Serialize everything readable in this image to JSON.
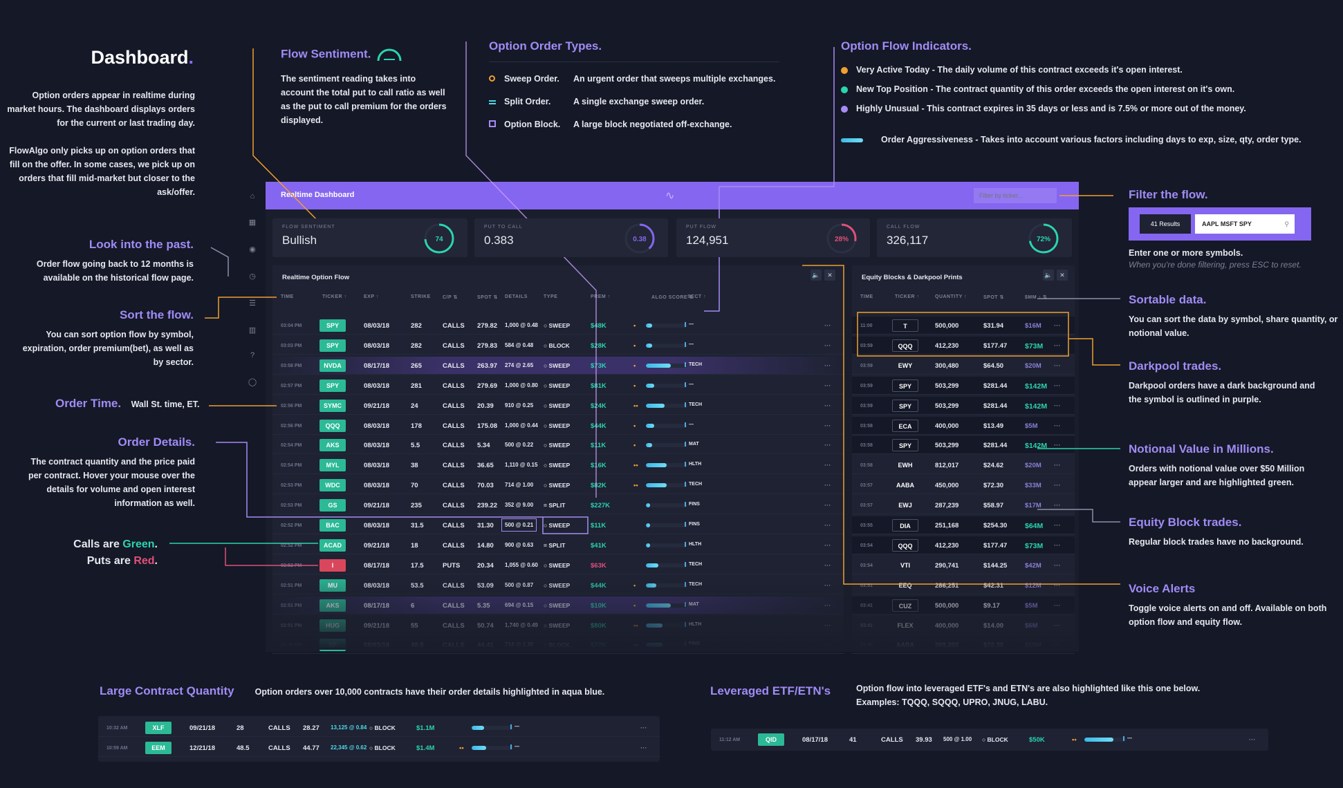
{
  "colors": {
    "accent": "#8566f0",
    "green": "#2bb996",
    "red": "#d9475c",
    "orange": "#f0a030",
    "aqua": "#4fd8e8"
  },
  "intro": {
    "title": "Dashboard",
    "p1": "Option orders appear in realtime during market hours. The dashboard displays orders for the current or last trading day.",
    "p2": "FlowAlgo only picks up on option orders that fill on the offer. In some cases, we pick up on orders that fill mid-market but closer to the ask/offer."
  },
  "left_notes": [
    {
      "title": "Look into the past.",
      "text": "Order flow going back to 12 months is available on the historical flow page."
    },
    {
      "title": "Sort the flow.",
      "text": "You can sort option flow by symbol, expiration, order premium(bet), as well as by sector."
    },
    {
      "title": "Order Time.",
      "text": "Wall St. time, ET."
    },
    {
      "title": "Order Details.",
      "text": "The contract quantity and the price paid per contract. Hover your mouse over the details for volume and open interest information as well."
    }
  ],
  "calls_puts": {
    "a": "Calls are ",
    "green": "Green",
    "b": "Puts are ",
    "red": "Red"
  },
  "sentiment_note": {
    "title": "Flow Sentiment.",
    "text": "The sentiment reading takes into account the total put to call ratio as well as the put to call premium for the orders displayed."
  },
  "order_types": {
    "title": "Option Order Types.",
    "items": [
      {
        "icon": "circle-outline-icon",
        "name": "Sweep Order.",
        "desc": "An urgent order that sweeps multiple exchanges."
      },
      {
        "icon": "double-line-icon",
        "name": "Split Order.",
        "desc": "A single exchange sweep order."
      },
      {
        "icon": "square-outline-icon",
        "name": "Option Block.",
        "desc": "A large block negotiated off-exchange."
      }
    ]
  },
  "indicators": {
    "title": "Option Flow Indicators.",
    "items": [
      {
        "color": "#f0a030",
        "name": "Very Active Today",
        "desc": " - The daily volume of this contract exceeds it's open interest."
      },
      {
        "color": "#2bd4b0",
        "name": "New Top Position",
        "desc": " - The contract quantity of this order exceeds the open interest on it's own."
      },
      {
        "color": "#a58cf5",
        "name": "Highly Unusual",
        "desc": " - This contract expires in 35 days or less and is 7.5% or more out of the money."
      },
      {
        "color": "bar",
        "name": "Order Aggressiveness",
        "desc": " - Takes into account various factors including days to exp, size, qty, order type."
      }
    ]
  },
  "right_notes": {
    "filter": {
      "title": "Filter the flow.",
      "results": "41 Results",
      "value": "AAPL MSFT SPY",
      "text": "Enter one or more symbols.",
      "hint": "When you're done filtering, press ESC to reset."
    },
    "sortable": {
      "title": "Sortable data.",
      "text": "You can sort the data by symbol, share quantity, or notional value."
    },
    "darkpool": {
      "title": "Darkpool trades.",
      "text": "Darkpool orders have a dark background and the symbol is outlined in purple."
    },
    "notional": {
      "title": "Notional Value in Millions.",
      "text": "Orders with notional value over $50 Million appear larger and are highlighted green."
    },
    "block": {
      "title": "Equity Block trades.",
      "text": "Regular block trades have no background."
    },
    "voice": {
      "title": "Voice Alerts",
      "text": "Toggle voice alerts on and off. Available on both option flow and equity flow."
    }
  },
  "app": {
    "header_title": "Realtime Dashboard",
    "search_placeholder": "Filter by ticker...",
    "cards": [
      {
        "label": "FLOW SENTIMENT",
        "value": "Bullish",
        "gauge": "74",
        "pct": 0.74,
        "color": "#2bd4b0"
      },
      {
        "label": "PUT TO CALL",
        "value": "0.383",
        "gauge": "0.38",
        "pct": 0.38,
        "color": "#8566f0"
      },
      {
        "label": "PUT FLOW",
        "value": "124,951",
        "gauge": "28%",
        "pct": 0.28,
        "color": "#e0507a"
      },
      {
        "label": "CALL FLOW",
        "value": "326,117",
        "gauge": "72%",
        "pct": 0.72,
        "color": "#2bd4b0"
      }
    ],
    "flow": {
      "title": "Realtime Option Flow",
      "headers": [
        "TIME",
        "TICKER ↑",
        "EXP ↑",
        "STRIKE",
        "C/P ⇅",
        "SPOT ⇅",
        "DETAILS",
        "TYPE",
        "PREM ↑",
        "ALGO SCORE ⇅",
        "SECT ↑"
      ],
      "rows": [
        [
          "03:04 PM",
          "SPY",
          "08/03/18",
          "282",
          "CALLS",
          "279.82",
          "1,000 @ 0.48",
          "SWEEP",
          "$48K",
          1,
          0.15,
          "—"
        ],
        [
          "03:03 PM",
          "SPY",
          "08/03/18",
          "282",
          "CALLS",
          "279.83",
          "584 @ 0.48",
          "BLOCK",
          "$28K",
          1,
          0.15,
          "—"
        ],
        [
          "03:58 PM",
          "NVDA",
          "08/17/18",
          "265",
          "CALLS",
          "263.97",
          "274 @ 2.65",
          "SWEEP",
          "$73K",
          1,
          0.6,
          "TECH"
        ],
        [
          "02:57 PM",
          "SPY",
          "08/03/18",
          "281",
          "CALLS",
          "279.69",
          "1,000 @ 0.80",
          "SWEEP",
          "$81K",
          1,
          0.2,
          "—"
        ],
        [
          "02:56 PM",
          "SYMC",
          "09/21/18",
          "24",
          "CALLS",
          "20.39",
          "910 @ 0.25",
          "SWEEP",
          "$24K",
          2,
          0.45,
          "TECH"
        ],
        [
          "02:56 PM",
          "QQQ",
          "08/03/18",
          "178",
          "CALLS",
          "175.08",
          "1,000 @ 0.44",
          "SWEEP",
          "$44K",
          1,
          0.2,
          "—"
        ],
        [
          "02:54 PM",
          "AKS",
          "08/03/18",
          "5.5",
          "CALLS",
          "5.34",
          "500 @ 0.22",
          "SWEEP",
          "$11K",
          1,
          0.15,
          "MAT"
        ],
        [
          "02:54 PM",
          "MYL",
          "08/03/18",
          "38",
          "CALLS",
          "36.65",
          "1,110 @ 0.15",
          "SWEEP",
          "$16K",
          2,
          0.5,
          "HLTH"
        ],
        [
          "02:53 PM",
          "WDC",
          "08/03/18",
          "70",
          "CALLS",
          "70.03",
          "714 @ 1.00",
          "SWEEP",
          "$82K",
          2,
          0.5,
          "TECH"
        ],
        [
          "02:53 PM",
          "GS",
          "09/21/18",
          "235",
          "CALLS",
          "239.22",
          "352 @ 9.00",
          "SPLIT",
          "$227K",
          0,
          0.1,
          "FINS"
        ],
        [
          "02:52 PM",
          "BAC",
          "08/03/18",
          "31.5",
          "CALLS",
          "31.30",
          "500 @ 0.21",
          "SWEEP",
          "$11K",
          0,
          0.1,
          "FINS"
        ],
        [
          "02:52 PM",
          "ACAD",
          "09/21/18",
          "18",
          "CALLS",
          "14.80",
          "900 @ 0.63",
          "SPLIT",
          "$41K",
          0,
          0.1,
          "HLTH"
        ],
        [
          "02:52 PM",
          "I",
          "08/17/18",
          "17.5",
          "PUTS",
          "20.34",
          "1,055 @ 0.60",
          "SWEEP",
          "$63K",
          0,
          0.3,
          "TECH"
        ],
        [
          "02:51 PM",
          "MU",
          "08/03/18",
          "53.5",
          "CALLS",
          "53.09",
          "500 @ 0.87",
          "SWEEP",
          "$44K",
          1,
          0.25,
          "TECH"
        ],
        [
          "02:51 PM",
          "AKS",
          "08/17/18",
          "6",
          "CALLS",
          "5.35",
          "694 @ 0.15",
          "SWEEP",
          "$10K",
          1,
          0.6,
          "MAT"
        ],
        [
          "02:51 PM",
          "HUG",
          "09/21/18",
          "55",
          "CALLS",
          "50.74",
          "1,740 @ 0.49",
          "SWEEP",
          "$80K",
          2,
          0.4,
          "HLTH"
        ],
        [
          "02:49 PM",
          "XP",
          "08/03/18",
          "48.5",
          "CALLS",
          "44.41",
          "714 @ 1.30",
          "BLOCK",
          "$77K",
          2,
          0.4,
          "FINS"
        ]
      ]
    },
    "equity": {
      "title": "Equity Blocks & Darkpool Prints",
      "headers": [
        "TIME",
        "TICKER ↑",
        "QUANTITY ↑",
        "SPOT ⇅",
        "$MM ↑ ⇅"
      ],
      "rows": [
        [
          "11:00",
          "T",
          "500,000",
          "$31.94",
          "$16M",
          true,
          false
        ],
        [
          "03:59",
          "QQQ",
          "412,230",
          "$177.47",
          "$73M",
          true,
          true
        ],
        [
          "03:59",
          "EWY",
          "300,480",
          "$64.50",
          "$20M",
          false,
          false
        ],
        [
          "03:59",
          "SPY",
          "503,299",
          "$281.44",
          "$142M",
          true,
          true
        ],
        [
          "03:59",
          "SPY",
          "503,299",
          "$281.44",
          "$142M",
          true,
          true
        ],
        [
          "03:58",
          "ECA",
          "400,000",
          "$13.49",
          "$5M",
          true,
          false
        ],
        [
          "03:58",
          "SPY",
          "503,299",
          "$281.44",
          "$142M",
          true,
          true
        ],
        [
          "03:58",
          "EWH",
          "812,017",
          "$24.62",
          "$20M",
          false,
          false
        ],
        [
          "03:57",
          "AABA",
          "450,000",
          "$72.30",
          "$33M",
          false,
          false
        ],
        [
          "03:57",
          "EWJ",
          "287,239",
          "$58.97",
          "$17M",
          false,
          false
        ],
        [
          "03:55",
          "DIA",
          "251,168",
          "$254.30",
          "$64M",
          true,
          true
        ],
        [
          "03:54",
          "QQQ",
          "412,230",
          "$177.47",
          "$73M",
          true,
          true
        ],
        [
          "03:54",
          "VTI",
          "290,741",
          "$144.25",
          "$42M",
          false,
          false
        ],
        [
          "03:51",
          "EEQ",
          "286,251",
          "$42.31",
          "$12M",
          false,
          false
        ],
        [
          "03:41",
          "CUZ",
          "500,000",
          "$9.17",
          "$5M",
          true,
          false
        ],
        [
          "03:41",
          "FLEX",
          "400,000",
          "$14.00",
          "$6M",
          false,
          false
        ],
        [
          "03:40",
          "AABA",
          "269,202",
          "$72.30",
          "$19M",
          false,
          false
        ]
      ]
    }
  },
  "large_contract": {
    "title": "Large Contract Quantity",
    "text": "Option orders over 10,000 contracts have their order details highlighted in aqua blue.",
    "rows": [
      [
        "10:32 AM",
        "XLF",
        "09/21/18",
        "28",
        "CALLS",
        "28.27",
        "13,125 @ 0.84",
        "BLOCK",
        "$1.1M",
        0,
        0.3,
        "—"
      ],
      [
        "10:59 AM",
        "EEM",
        "12/21/18",
        "48.5",
        "CALLS",
        "44.77",
        "22,345 @ 0.62",
        "BLOCK",
        "$1.4M",
        2,
        0.35,
        "—"
      ]
    ]
  },
  "leveraged": {
    "title": "Leveraged ETF/ETN's",
    "text1": "Option flow into leveraged ETF's and ETN's are also highlighted like this one below.",
    "text2": "Examples: TQQQ, SQQQ, UPRO, JNUG, LABU.",
    "rows": [
      [
        "11:12 AM",
        "QID",
        "08/17/18",
        "41",
        "CALLS",
        "39.93",
        "500 @ 1.00",
        "BLOCK",
        "$50K",
        2,
        0.7,
        "—"
      ]
    ]
  }
}
